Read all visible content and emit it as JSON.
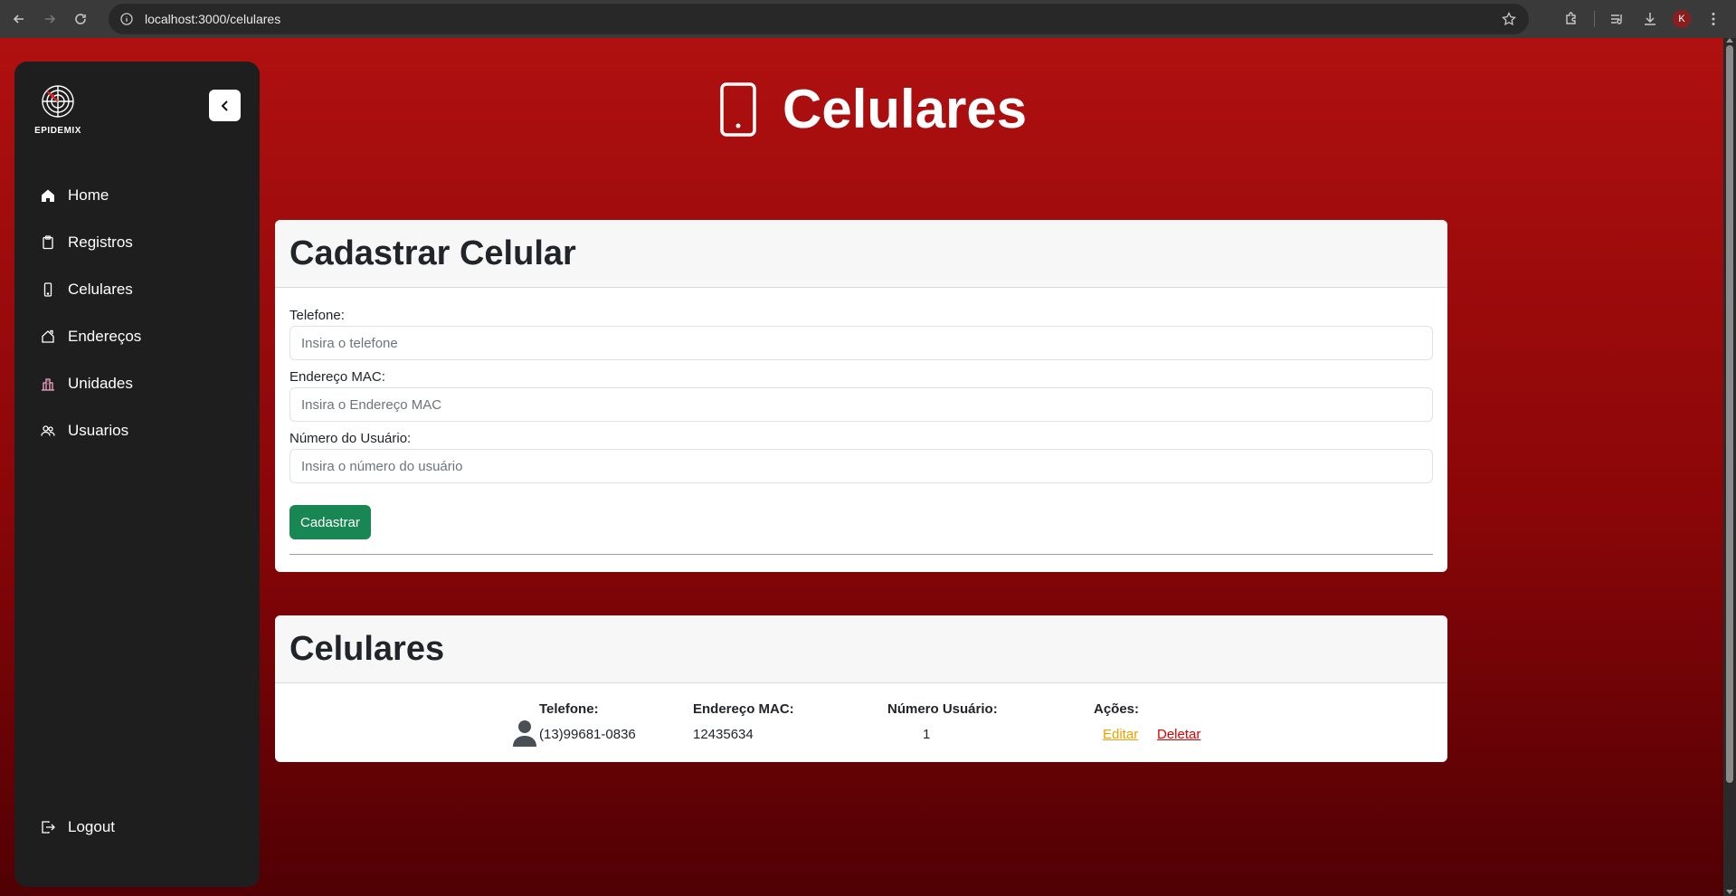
{
  "browser": {
    "url": "localhost:3000/celulares",
    "profile_initial": "K"
  },
  "sidebar": {
    "logo_text": "EPIDEMIX",
    "items": [
      {
        "label": "Home",
        "icon": "home-icon"
      },
      {
        "label": "Registros",
        "icon": "clipboard-icon"
      },
      {
        "label": "Celulares",
        "icon": "phone-icon"
      },
      {
        "label": "Endereços",
        "icon": "house-icon"
      },
      {
        "label": "Unidades",
        "icon": "building-icon"
      },
      {
        "label": "Usuarios",
        "icon": "people-icon"
      }
    ],
    "logout_label": "Logout"
  },
  "header": {
    "title": "Celulares"
  },
  "form": {
    "title": "Cadastrar Celular",
    "fields": [
      {
        "label": "Telefone:",
        "placeholder": "Insira o telefone",
        "value": ""
      },
      {
        "label": "Endereço MAC:",
        "placeholder": "Insira o Endereço MAC",
        "value": ""
      },
      {
        "label": "Número do Usuário:",
        "placeholder": "Insira o número do usuário",
        "value": ""
      }
    ],
    "submit_label": "Cadastrar"
  },
  "list": {
    "title": "Celulares",
    "columns": [
      "Telefone:",
      "Endereço MAC:",
      "Número Usuário:",
      "Ações:"
    ],
    "rows": [
      {
        "telefone": "(13)99681-0836",
        "mac": "12435634",
        "usuario": "1",
        "edit_label": "Editar",
        "delete_label": "Deletar"
      }
    ]
  },
  "colors": {
    "accent_red": "#b01010",
    "sidebar_bg": "#1e1e1e",
    "submit_green": "#198754",
    "edit_orange": "#f0a000",
    "delete_red": "#dc0000"
  }
}
